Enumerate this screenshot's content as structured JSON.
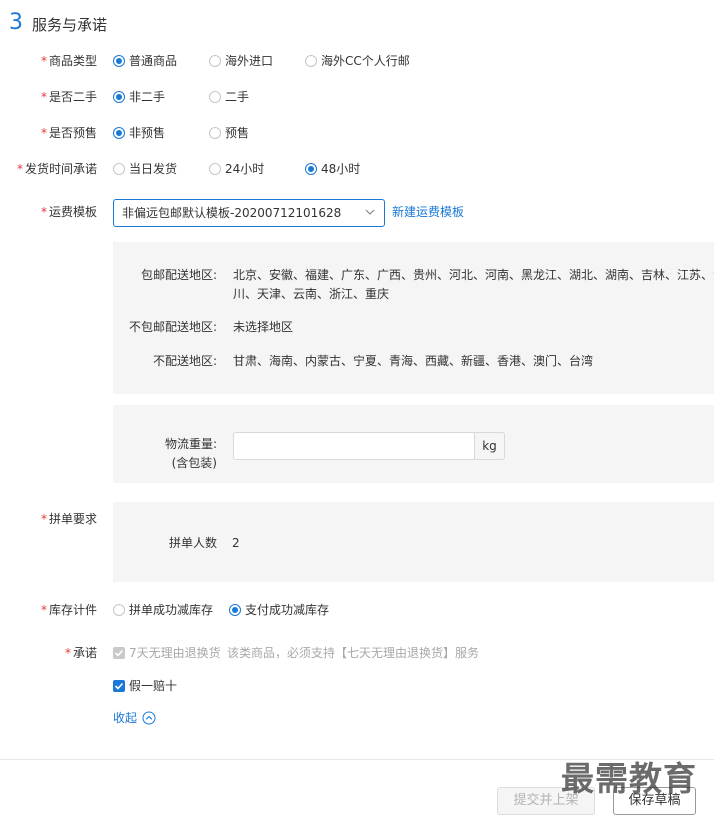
{
  "section": {
    "number": "3",
    "title": "服务与承诺"
  },
  "product_type": {
    "label": "商品类型",
    "options": [
      "普通商品",
      "海外进口",
      "海外CC个人行邮"
    ],
    "selected": "普通商品"
  },
  "second_hand": {
    "label": "是否二手",
    "options": [
      "非二手",
      "二手"
    ],
    "selected": "非二手"
  },
  "presale": {
    "label": "是否预售",
    "options": [
      "非预售",
      "预售"
    ],
    "selected": "非预售"
  },
  "ship_time": {
    "label": "发货时间承诺",
    "options": [
      "当日发货",
      "24小时",
      "48小时"
    ],
    "selected": "48小时"
  },
  "freight": {
    "label": "运费模板",
    "selected": "非偏远包邮默认模板-20200712101628",
    "new_link": "新建运费模板",
    "free_label": "包邮配送地区:",
    "free_line1": "北京、安徽、福建、广东、广西、贵州、河北、河南、黑龙江、湖北、湖南、吉林、江苏、江",
    "free_line2": "川、天津、云南、浙江、重庆",
    "nonfree_label": "不包邮配送地区:",
    "nonfree_value": "未选择地区",
    "nodelivery_label": "不配送地区:",
    "nodelivery_value": "甘肃、海南、内蒙古、宁夏、青海、西藏、新疆、香港、澳门、台湾"
  },
  "weight": {
    "label_line1": "物流重量:",
    "label_line2": "(含包装)",
    "value": "",
    "unit": "kg"
  },
  "group": {
    "label": "拼单要求",
    "people_label": "拼单人数",
    "people_value": "2"
  },
  "inventory": {
    "label": "库存计件",
    "options": [
      "拼单成功减库存",
      "支付成功减库存"
    ],
    "selected": "支付成功减库存"
  },
  "promise": {
    "label": "承诺",
    "item1": "7天无理由退换货",
    "item1_note": "该类商品，必须支持【七天无理由退换货】服务",
    "item2": "假一赔十",
    "collapse": "收起"
  },
  "buttons": {
    "submit": "提交并上架",
    "save": "保存草稿"
  },
  "watermark": "最需教育",
  "colors": {
    "accent": "#1a78d6",
    "required": "#e4393c",
    "panel": "#f5f5f5"
  }
}
